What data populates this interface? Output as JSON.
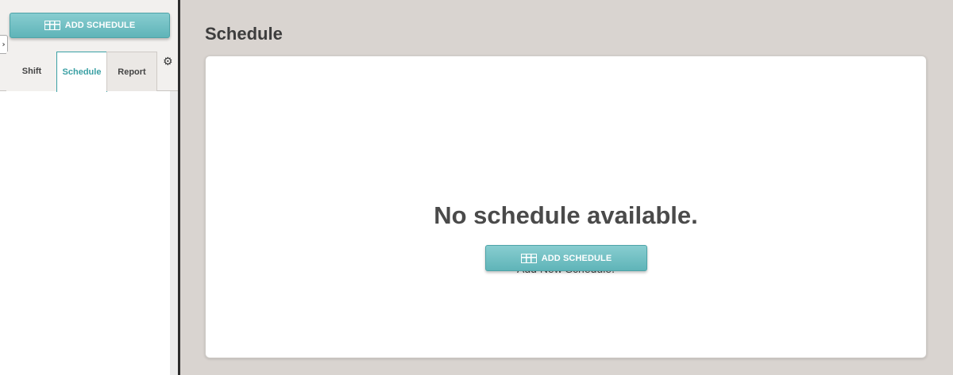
{
  "sidebar": {
    "add_button_label": "ADD SCHEDULE",
    "collapse_glyph": "›",
    "tabs": [
      {
        "label": "Shift"
      },
      {
        "label": "Schedule"
      },
      {
        "label": "Report"
      }
    ],
    "active_tab": "Schedule",
    "settings_icon": "gear-icon"
  },
  "main": {
    "title": "Schedule",
    "empty_state": {
      "heading": "No schedule available.",
      "subtext": "Add New Schedule.",
      "button_label": "ADD SCHEDULE"
    }
  },
  "colors": {
    "accent": "#5fb4b8",
    "active_tab_text": "#3aa0a4",
    "background": "#d9d4d0"
  }
}
